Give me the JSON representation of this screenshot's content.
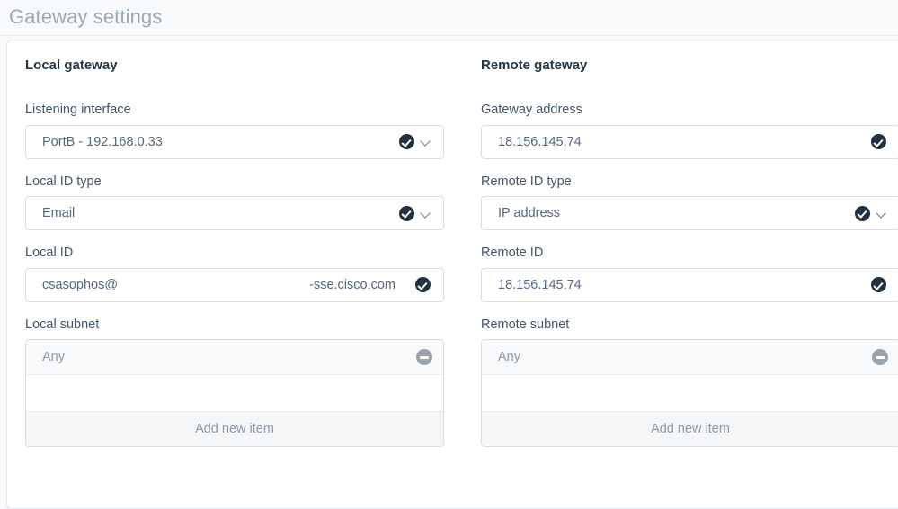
{
  "header": {
    "title": "Gateway settings"
  },
  "local": {
    "section_title": "Local gateway",
    "listening_interface": {
      "label": "Listening interface",
      "value": "PortB - 192.168.0.33",
      "check_icon": "check-circle-icon",
      "chevron_icon": "chevron-down-icon"
    },
    "id_type": {
      "label": "Local ID type",
      "value": "Email",
      "check_icon": "check-circle-icon",
      "chevron_icon": "chevron-down-icon"
    },
    "id": {
      "label": "Local ID",
      "value_prefix": "csasophos@",
      "value_suffix": "-sse.cisco.com",
      "check_icon": "check-circle-icon"
    },
    "subnet": {
      "label": "Local subnet",
      "items": [
        "Any"
      ],
      "remove_icon": "minus-circle-icon",
      "add_label": "Add new item"
    }
  },
  "remote": {
    "section_title": "Remote gateway",
    "gateway_address": {
      "label": "Gateway address",
      "value": "18.156.145.74",
      "check_icon": "check-circle-icon"
    },
    "id_type": {
      "label": "Remote ID type",
      "value": "IP address",
      "check_icon": "check-circle-icon",
      "chevron_icon": "chevron-down-icon"
    },
    "id": {
      "label": "Remote ID",
      "value": "18.156.145.74",
      "check_icon": "check-circle-icon"
    },
    "subnet": {
      "label": "Remote subnet",
      "items": [
        "Any"
      ],
      "remove_icon": "minus-circle-icon",
      "add_label": "Add new item"
    }
  },
  "colors": {
    "page_background": "#f9fafb",
    "card_background": "#ffffff",
    "title": "#9aa7b4",
    "label": "#42566b",
    "value": "#56677d",
    "badge_dark": "#22303f",
    "badge_grey": "#9aa4ae"
  }
}
